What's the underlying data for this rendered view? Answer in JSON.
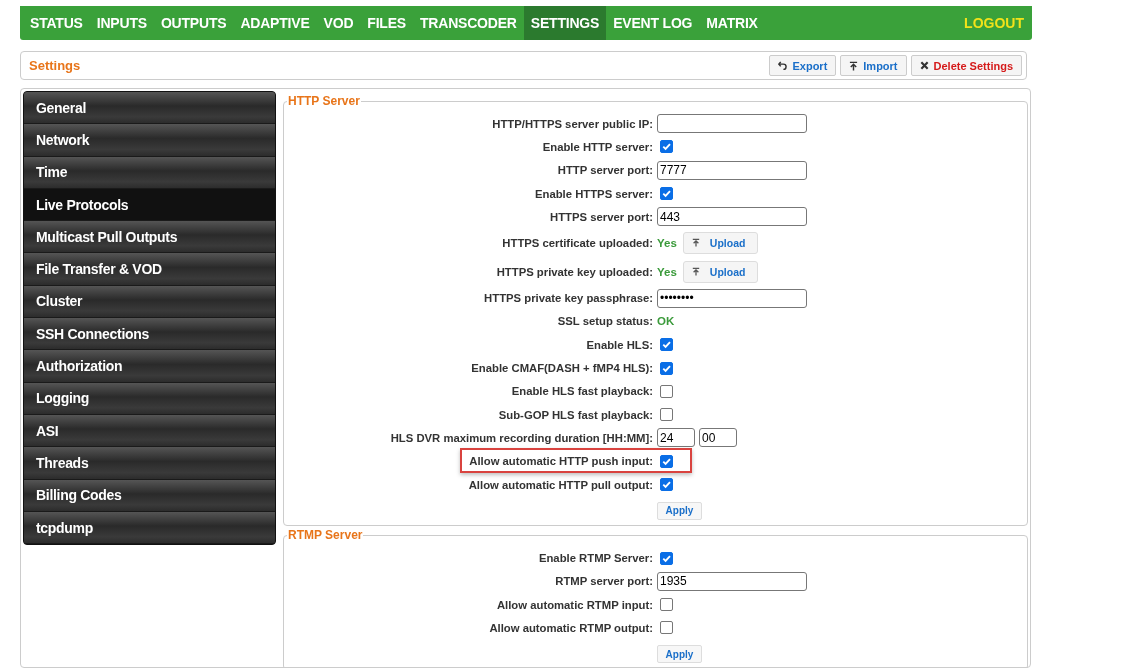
{
  "nav": {
    "items": [
      {
        "label": "STATUS",
        "selected": false
      },
      {
        "label": "INPUTS",
        "selected": false
      },
      {
        "label": "OUTPUTS",
        "selected": false
      },
      {
        "label": "ADAPTIVE",
        "selected": false
      },
      {
        "label": "VOD",
        "selected": false
      },
      {
        "label": "FILES",
        "selected": false
      },
      {
        "label": "TRANSCODER",
        "selected": false
      },
      {
        "label": "SETTINGS",
        "selected": true
      },
      {
        "label": "EVENT LOG",
        "selected": false
      },
      {
        "label": "MATRIX",
        "selected": false
      }
    ],
    "logout": "LOGOUT"
  },
  "page_header": {
    "title": "Settings",
    "buttons": [
      {
        "kind": "export",
        "label": "Export"
      },
      {
        "kind": "import",
        "label": "Import"
      },
      {
        "kind": "delete",
        "label": "Delete Settings"
      }
    ]
  },
  "sidebar": {
    "items": [
      {
        "label": "General",
        "selected": false
      },
      {
        "label": "Network",
        "selected": false
      },
      {
        "label": "Time",
        "selected": false
      },
      {
        "label": "Live Protocols",
        "selected": true
      },
      {
        "label": "Multicast Pull Outputs",
        "selected": false
      },
      {
        "label": "File Transfer & VOD",
        "selected": false
      },
      {
        "label": "Cluster",
        "selected": false
      },
      {
        "label": "SSH Connections",
        "selected": false
      },
      {
        "label": "Authorization",
        "selected": false
      },
      {
        "label": "Logging",
        "selected": false
      },
      {
        "label": "ASI",
        "selected": false
      },
      {
        "label": "Threads",
        "selected": false
      },
      {
        "label": "Billing Codes",
        "selected": false
      },
      {
        "label": "tcpdump",
        "selected": false
      }
    ]
  },
  "sections": [
    {
      "title": "HTTP Server",
      "rows": [
        {
          "kind": "text",
          "label": "HTTP/HTTPS server public IP:",
          "highlighted": false
        },
        {
          "kind": "checkbox",
          "label": "Enable HTTP server:",
          "checked": true,
          "highlighted": false
        },
        {
          "kind": "text",
          "label": "HTTP server port:",
          "value": "7777",
          "highlighted": false
        },
        {
          "kind": "checkbox",
          "label": "Enable HTTPS server:",
          "checked": true,
          "highlighted": false
        },
        {
          "kind": "text",
          "label": "HTTPS server port:",
          "value": "443",
          "highlighted": false
        },
        {
          "kind": "upload",
          "label": "HTTPS certificate uploaded:",
          "status": "Yes",
          "button": "Upload",
          "highlighted": false
        },
        {
          "kind": "upload",
          "label": "HTTPS private key uploaded:",
          "status": "Yes",
          "button": "Upload",
          "highlighted": false
        },
        {
          "kind": "text",
          "label": "HTTPS private key passphrase:",
          "value": "••••••••",
          "highlighted": false
        },
        {
          "kind": "status",
          "label": "SSL setup status:",
          "status": "OK",
          "highlighted": false
        },
        {
          "kind": "checkbox",
          "label": "Enable HLS:",
          "checked": true,
          "highlighted": false
        },
        {
          "kind": "checkbox",
          "label": "Enable CMAF(DASH + fMP4 HLS):",
          "checked": true,
          "highlighted": false
        },
        {
          "kind": "checkbox",
          "label": "Enable HLS fast playback:",
          "checked": false,
          "highlighted": false
        },
        {
          "kind": "checkbox",
          "label": "Sub-GOP HLS fast playback:",
          "checked": false,
          "highlighted": false
        },
        {
          "kind": "duration",
          "label": "HLS DVR maximum recording duration [HH:MM]:",
          "hours": "24",
          "minutes": "00",
          "highlighted": false
        },
        {
          "kind": "checkbox",
          "label": "Allow automatic HTTP push input:",
          "checked": true,
          "highlighted": true
        },
        {
          "kind": "checkbox",
          "label": "Allow automatic HTTP pull output:",
          "checked": true,
          "highlighted": false
        }
      ],
      "apply": "Apply"
    },
    {
      "title": "RTMP Server",
      "rows": [
        {
          "kind": "checkbox",
          "label": "Enable RTMP Server:",
          "checked": true,
          "highlighted": false
        },
        {
          "kind": "text",
          "label": "RTMP server port:",
          "value": "1935",
          "highlighted": false
        },
        {
          "kind": "checkbox",
          "label": "Allow automatic RTMP input:",
          "checked": false,
          "highlighted": false
        },
        {
          "kind": "checkbox",
          "label": "Allow automatic RTMP output:",
          "checked": false,
          "highlighted": false
        }
      ],
      "apply": "Apply"
    }
  ]
}
